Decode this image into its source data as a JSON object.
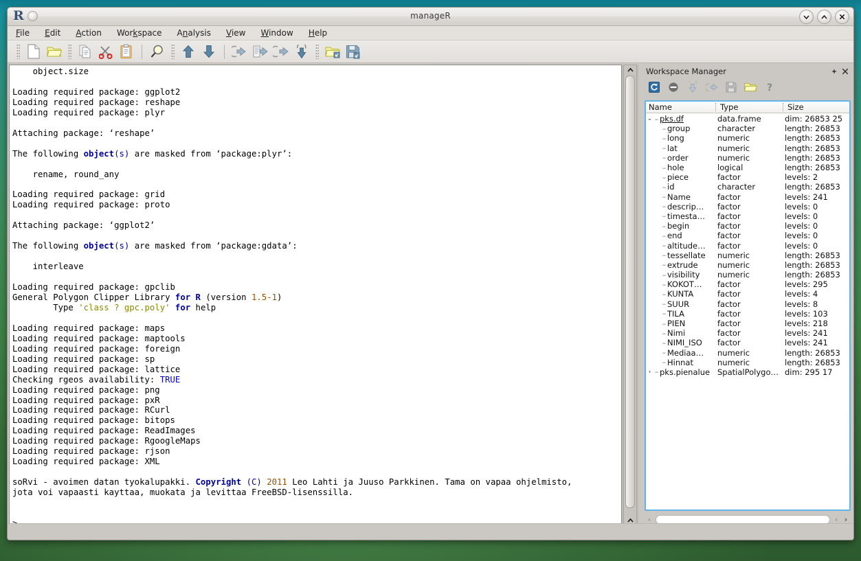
{
  "window": {
    "title": "manageR",
    "logo": "R",
    "controls": [
      {
        "name": "minimize-button",
        "glyph": "chevron-down"
      },
      {
        "name": "maximize-button",
        "glyph": "chevron-up"
      },
      {
        "name": "close-button",
        "glyph": "x"
      }
    ]
  },
  "menubar": {
    "items": [
      {
        "label": "File",
        "mnemonic": "F"
      },
      {
        "label": "Edit",
        "mnemonic": "E"
      },
      {
        "label": "Action",
        "mnemonic": "A"
      },
      {
        "label": "Workspace",
        "mnemonic": "k"
      },
      {
        "label": "Analysis",
        "mnemonic": "n"
      },
      {
        "label": "View",
        "mnemonic": "V"
      },
      {
        "label": "Window",
        "mnemonic": "W"
      },
      {
        "label": "Help",
        "mnemonic": "H"
      }
    ]
  },
  "toolbar": {
    "buttons": [
      {
        "name": "new-file-icon",
        "tip": "New"
      },
      {
        "name": "open-folder-icon",
        "tip": "Open"
      },
      {
        "name": "copy-icon",
        "tip": "Copy"
      },
      {
        "name": "cut-scissors-icon",
        "tip": "Cut"
      },
      {
        "name": "paste-clipboard-icon",
        "tip": "Paste"
      },
      {
        "name": "search-magnifier-icon",
        "tip": "Find"
      },
      {
        "name": "arrow-up-icon",
        "tip": "Previous command"
      },
      {
        "name": "arrow-down-icon",
        "tip": "Next command"
      },
      {
        "name": "run-back-icon",
        "tip": "Run previous"
      },
      {
        "name": "run-selection-icon",
        "tip": "Run selection"
      },
      {
        "name": "run-forward-icon",
        "tip": "Run next"
      },
      {
        "name": "run-all-icon",
        "tip": "Run all"
      },
      {
        "name": "load-workspace-icon",
        "tip": "Load workspace"
      },
      {
        "name": "save-workspace-icon",
        "tip": "Save workspace"
      }
    ]
  },
  "console": {
    "prompt": ">",
    "lines": [
      "    object.size",
      "",
      "Loading required package: ggplot2",
      "Loading required package: reshape",
      "Loading required package: plyr",
      "",
      "Attaching package: ‘reshape’",
      "",
      "The following object(s) are masked from ‘package:plyr’:",
      "",
      "    rename, round_any",
      "",
      "Loading required package: grid",
      "Loading required package: proto",
      "",
      "Attaching package: ‘ggplot2’",
      "",
      "The following object(s) are masked from ‘package:gdata’:",
      "",
      "    interleave",
      "",
      "Loading required package: gpclib",
      "General Polygon Clipper Library for R (version 1.5-1)",
      "        Type 'class ? gpc.poly' for help",
      "",
      "Loading required package: maps",
      "Loading required package: maptools",
      "Loading required package: foreign",
      "Loading required package: sp",
      "Loading required package: lattice",
      "Checking rgeos availability: TRUE",
      "Loading required package: png",
      "Loading required package: pxR",
      "Loading required package: RCurl",
      "Loading required package: bitops",
      "Loading required package: ReadImages",
      "Loading required package: RgoogleMaps",
      "Loading required package: rjson",
      "Loading required package: XML",
      "",
      "soRvi - avoimen datan tyokalupakki. Copyright (C) 2011 Leo Lahti ja Juuso Parkkinen. Tama on vapaa ohjelmisto,",
      "jota voi vapaasti kayttaa, muokata ja levittaa FreeBSD-lisenssilla.",
      "",
      "",
      ">"
    ],
    "syntax_colors": {
      "keyword": "#00009a",
      "number": "#9a5000",
      "string": "#8a8a00",
      "boolean": "#0000cc",
      "text": "#000000"
    }
  },
  "workspace_manager": {
    "title": "Workspace Manager",
    "float_button": "float-icon",
    "close_button": "close-icon",
    "toolbar": [
      {
        "name": "refresh-workspace-icon",
        "tip": "Refresh"
      },
      {
        "name": "remove-object-icon",
        "tip": "Remove"
      },
      {
        "name": "import-object-icon",
        "tip": "Import"
      },
      {
        "name": "export-object-icon",
        "tip": "Export"
      },
      {
        "name": "save-workspace-icon",
        "tip": "Save workspace"
      },
      {
        "name": "load-workspace-icon",
        "tip": "Load workspace"
      },
      {
        "name": "help-question-icon",
        "tip": "Help"
      }
    ],
    "columns": [
      "Name",
      "Type",
      "Size"
    ],
    "rows": [
      {
        "level": 0,
        "expanded": true,
        "name": "pks.df",
        "type": "data.frame",
        "size": "dim: 26853 25"
      },
      {
        "level": 1,
        "expanded": false,
        "name": "group",
        "type": "character",
        "size": "length: 26853"
      },
      {
        "level": 1,
        "expanded": false,
        "name": "long",
        "type": "numeric",
        "size": "length: 26853"
      },
      {
        "level": 1,
        "expanded": false,
        "name": "lat",
        "type": "numeric",
        "size": "length: 26853"
      },
      {
        "level": 1,
        "expanded": false,
        "name": "order",
        "type": "numeric",
        "size": "length: 26853"
      },
      {
        "level": 1,
        "expanded": false,
        "name": "hole",
        "type": "logical",
        "size": "length: 26853"
      },
      {
        "level": 1,
        "expanded": false,
        "name": "piece",
        "type": "factor",
        "size": "levels: 2"
      },
      {
        "level": 1,
        "expanded": false,
        "name": "id",
        "type": "character",
        "size": "length: 26853"
      },
      {
        "level": 1,
        "expanded": false,
        "name": "Name",
        "type": "factor",
        "size": "levels: 241"
      },
      {
        "level": 1,
        "expanded": false,
        "name": "descrip…",
        "type": "factor",
        "size": "levels: 0"
      },
      {
        "level": 1,
        "expanded": false,
        "name": "timesta…",
        "type": "factor",
        "size": "levels: 0"
      },
      {
        "level": 1,
        "expanded": false,
        "name": "begin",
        "type": "factor",
        "size": "levels: 0"
      },
      {
        "level": 1,
        "expanded": false,
        "name": "end",
        "type": "factor",
        "size": "levels: 0"
      },
      {
        "level": 1,
        "expanded": false,
        "name": "altitude…",
        "type": "factor",
        "size": "levels: 0"
      },
      {
        "level": 1,
        "expanded": false,
        "name": "tessellate",
        "type": "numeric",
        "size": "length: 26853"
      },
      {
        "level": 1,
        "expanded": false,
        "name": "extrude",
        "type": "numeric",
        "size": "length: 26853"
      },
      {
        "level": 1,
        "expanded": false,
        "name": "visibility",
        "type": "numeric",
        "size": "length: 26853"
      },
      {
        "level": 1,
        "expanded": false,
        "name": "KOKOT…",
        "type": "factor",
        "size": "levels: 295"
      },
      {
        "level": 1,
        "expanded": false,
        "name": "KUNTA",
        "type": "factor",
        "size": "levels: 4"
      },
      {
        "level": 1,
        "expanded": false,
        "name": "SUUR",
        "type": "factor",
        "size": "levels: 8"
      },
      {
        "level": 1,
        "expanded": false,
        "name": "TILA",
        "type": "factor",
        "size": "levels: 103"
      },
      {
        "level": 1,
        "expanded": false,
        "name": "PIEN",
        "type": "factor",
        "size": "levels: 218"
      },
      {
        "level": 1,
        "expanded": false,
        "name": "Nimi",
        "type": "factor",
        "size": "levels: 241"
      },
      {
        "level": 1,
        "expanded": false,
        "name": "NIMI_ISO",
        "type": "factor",
        "size": "levels: 241"
      },
      {
        "level": 1,
        "expanded": false,
        "name": "Mediaa…",
        "type": "numeric",
        "size": "length: 26853"
      },
      {
        "level": 1,
        "expanded": false,
        "name": "Hinnat",
        "type": "numeric",
        "size": "length: 26853"
      },
      {
        "level": 0,
        "expanded": false,
        "name": "pks.pienalue",
        "type": "SpatialPolygo…",
        "size": "dim: 295 17"
      }
    ]
  },
  "colors": {
    "accent": "#63b3e8",
    "window_bg": "#cbc7c2",
    "console_bg": "#ffffff",
    "desktop_top": "#17909e",
    "desktop_bottom": "#2c5a2e"
  }
}
